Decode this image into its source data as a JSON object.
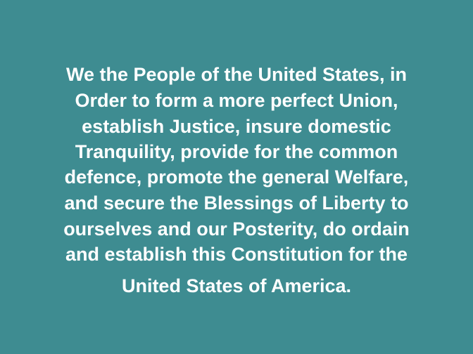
{
  "slide": {
    "background_color": "#3e8c91",
    "text_color": "#ffffff",
    "lines": [
      "We the People of the United States, in",
      "Order to form a more perfect Union,",
      "establish Justice, insure domestic",
      "Tranquility, provide for the common",
      "defence, promote the general Welfare,",
      "and secure the Blessings of Liberty to",
      "ourselves and our Posterity, do ordain",
      "and establish this Constitution for the",
      "United States of America."
    ]
  }
}
